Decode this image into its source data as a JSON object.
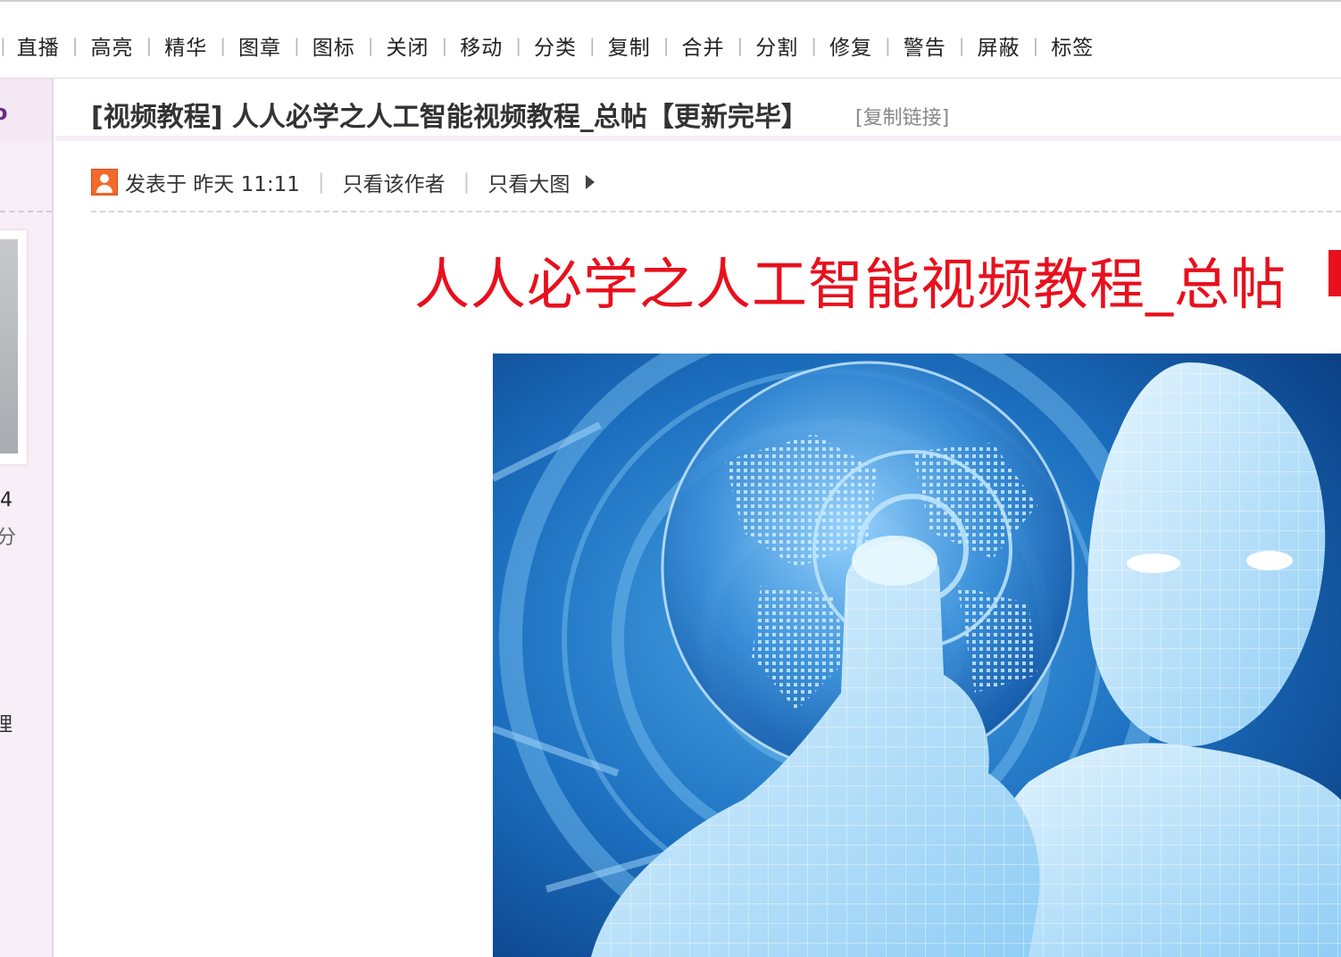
{
  "toolbar": {
    "items": [
      "直播",
      "高亮",
      "精华",
      "图章",
      "图标",
      "关闭",
      "移动",
      "分类",
      "复制",
      "合并",
      "分割",
      "修复",
      "警告",
      "屏蔽",
      "标签"
    ],
    "separator": "|"
  },
  "sidebar": {
    "head_glyph": "o",
    "stat_number": "4",
    "stat_unit": "分",
    "manage_label": "理"
  },
  "thread": {
    "title": "[视频教程] 人人必学之人工智能视频教程_总帖【更新完毕】",
    "copy_link": "[复制链接]"
  },
  "post": {
    "posted_label": "发表于 昨天 11:11",
    "only_author": "只看该作者",
    "only_large_image": "只看大图",
    "separator": "|",
    "headline": "人人必学之人工智能视频教程_总帖"
  },
  "colors": {
    "accent_red": "#e8101d",
    "sidebar_bg": "#f7eef7",
    "image_blue": "#1f77c4"
  }
}
